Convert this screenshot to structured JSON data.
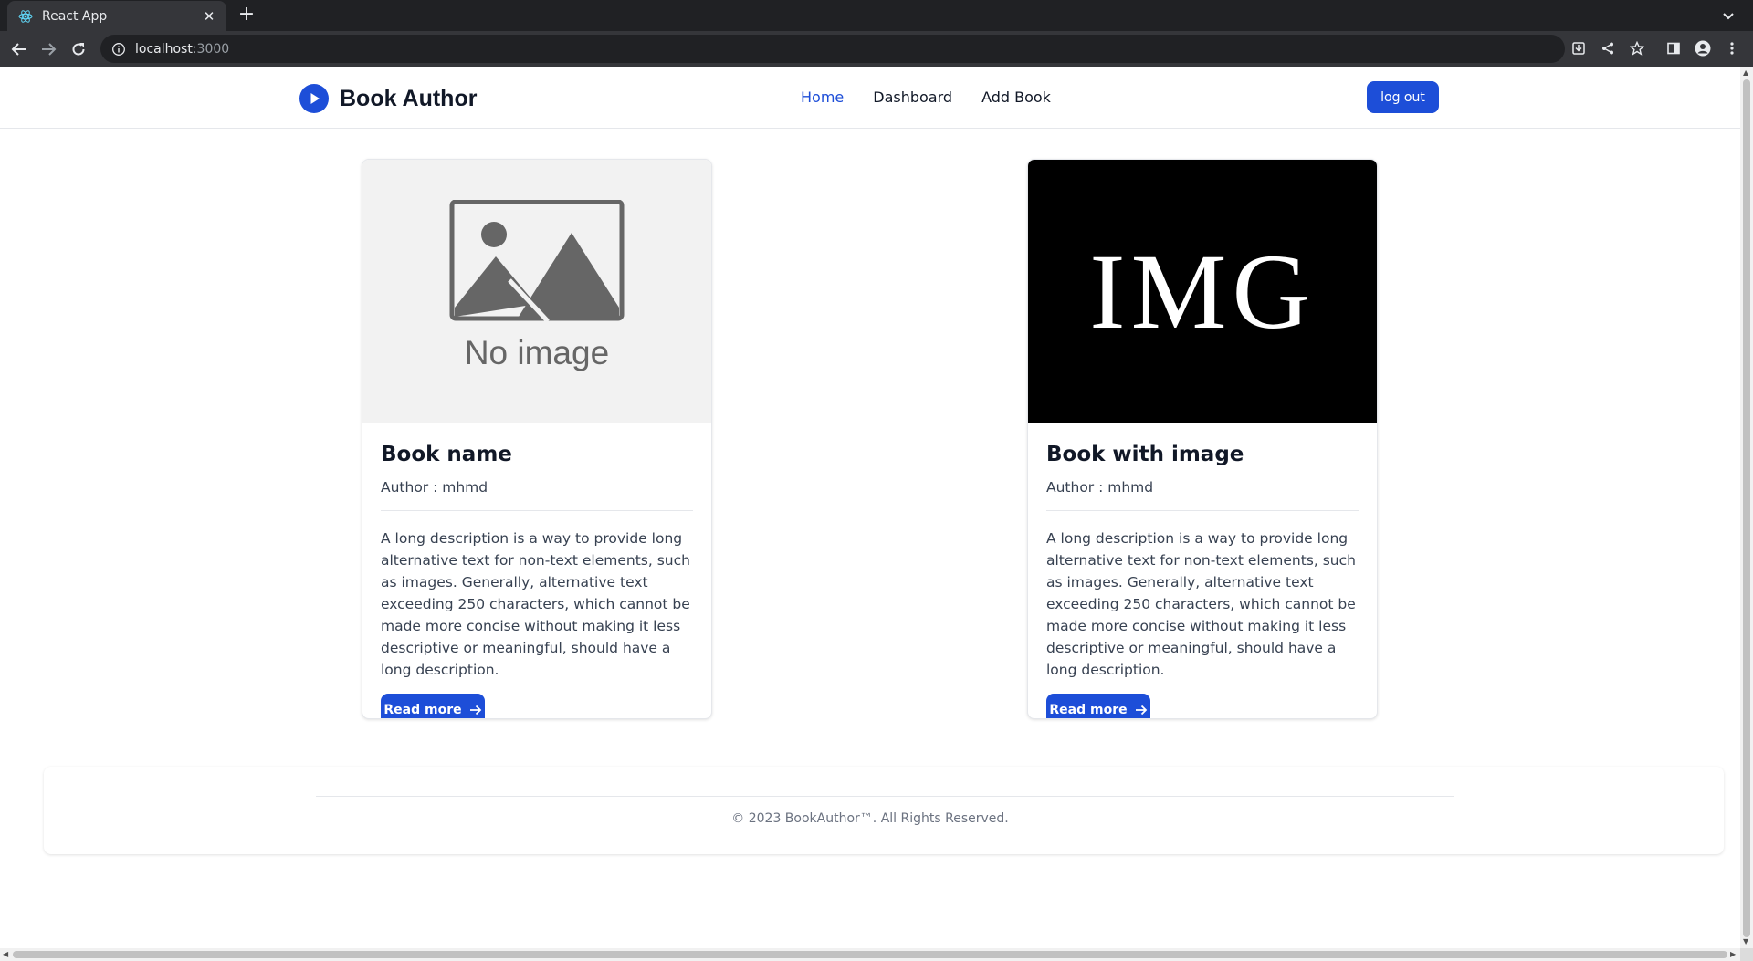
{
  "browser": {
    "tab_title": "React App",
    "url_host": "localhost",
    "url_port": ":3000"
  },
  "navbar": {
    "brand": "Book Author",
    "links": [
      {
        "label": "Home",
        "active": true
      },
      {
        "label": "Dashboard",
        "active": false
      },
      {
        "label": "Add Book",
        "active": false
      }
    ],
    "logout_label": "log out"
  },
  "books": [
    {
      "title": "Book name",
      "author": "Author : mhmd",
      "image": "placeholder",
      "image_text": "No image",
      "description": "A long description is a way to provide long alternative text for non-text elements, such as images. Generally, alternative text exceeding 250 characters, which cannot be made more concise without making it less descriptive or meaningful, should have a long description.",
      "button": "Read more"
    },
    {
      "title": "Book with image",
      "author": "Author : mhmd",
      "image": "img-logo",
      "image_text": "IMG",
      "description": "A long description is a way to provide long alternative text for non-text elements, such as images. Generally, alternative text exceeding 250 characters, which cannot be made more concise without making it less descriptive or meaningful, should have a long description.",
      "button": "Read more"
    }
  ],
  "footer": {
    "text": "© 2023 BookAuthor™. All Rights Reserved."
  },
  "colors": {
    "accent": "#1d4ed8",
    "chrome_dark": "#202124",
    "chrome_mid": "#35363a",
    "text_dark": "#111827"
  }
}
